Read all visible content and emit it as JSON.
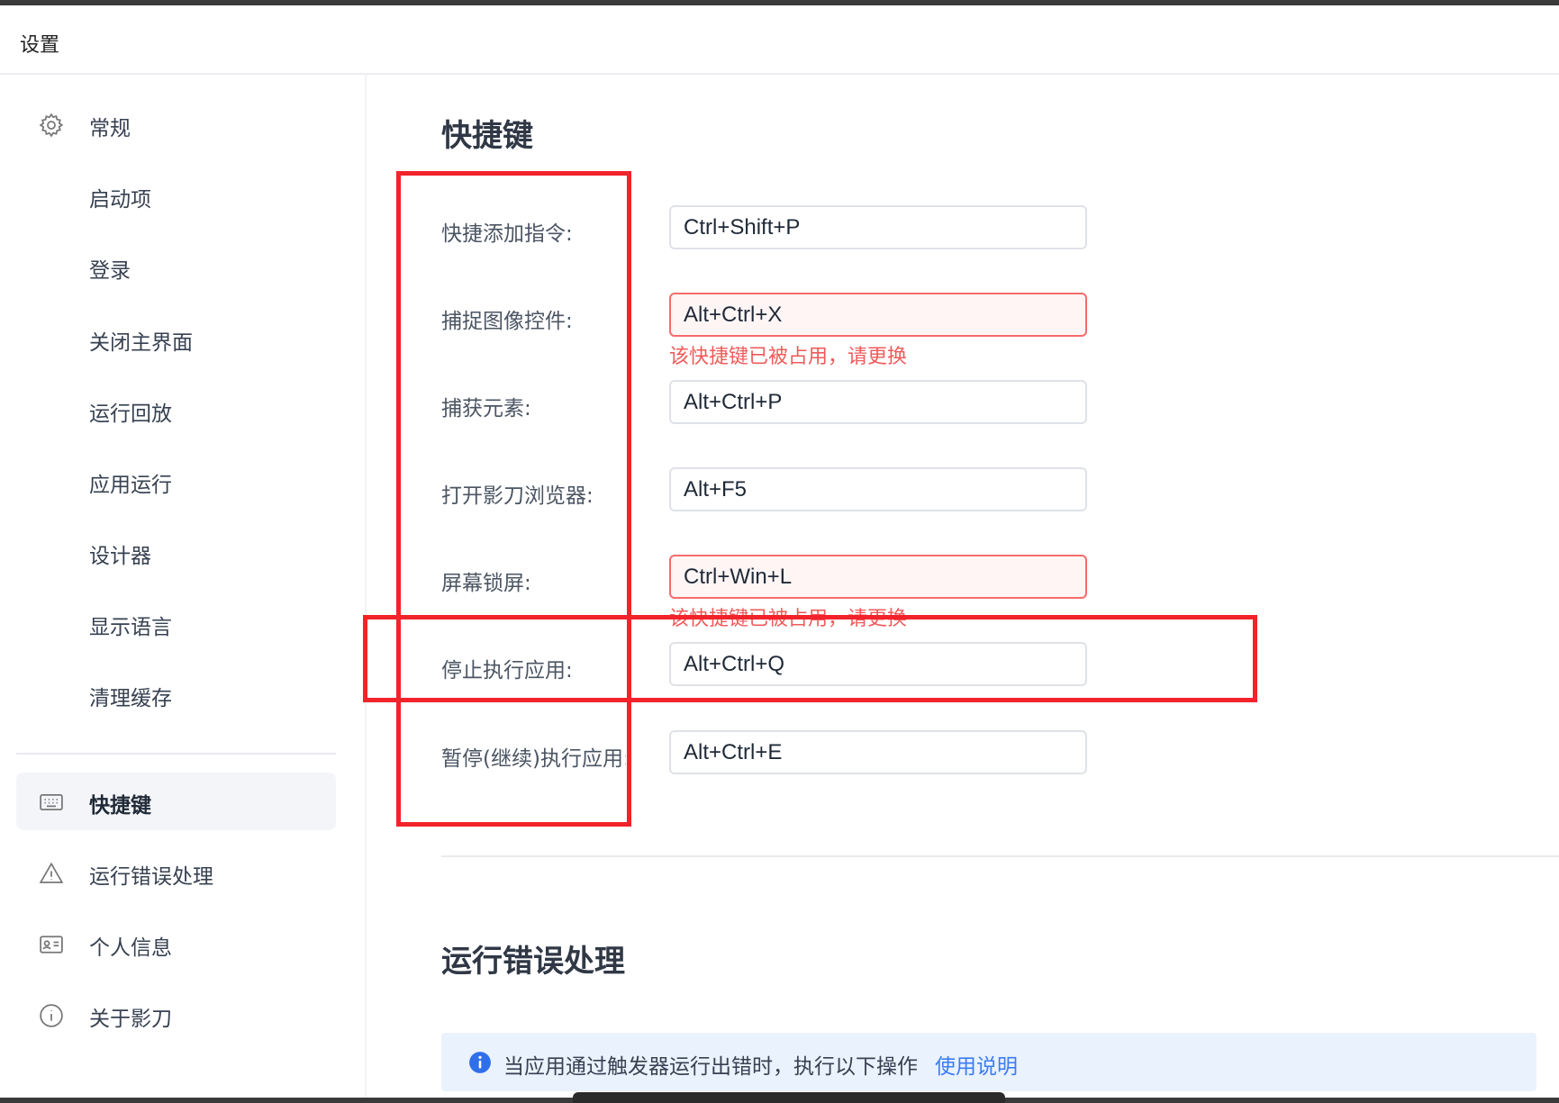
{
  "window": {
    "title": "设置"
  },
  "sidebar": {
    "items": [
      {
        "label": "常规",
        "icon": "gear-icon"
      },
      {
        "label": "启动项"
      },
      {
        "label": "登录"
      },
      {
        "label": "关闭主界面"
      },
      {
        "label": "运行回放"
      },
      {
        "label": "应用运行"
      },
      {
        "label": "设计器"
      },
      {
        "label": "显示语言"
      },
      {
        "label": "清理缓存"
      },
      {
        "label": "快捷键",
        "icon": "keyboard-icon",
        "active": true
      },
      {
        "label": "运行错误处理",
        "icon": "warning-icon"
      },
      {
        "label": "个人信息",
        "icon": "id-card-icon"
      },
      {
        "label": "关于影刀",
        "icon": "info-icon"
      }
    ]
  },
  "shortcuts": {
    "title": "快捷键",
    "fields": [
      {
        "label": "快捷添加指令:",
        "value": "Ctrl+Shift+P"
      },
      {
        "label": "捕捉图像控件:",
        "value": "Alt+Ctrl+X",
        "error": "该快捷键已被占用，请更换"
      },
      {
        "label": "捕获元素:",
        "value": "Alt+Ctrl+P"
      },
      {
        "label": "打开影刀浏览器:",
        "value": "Alt+F5"
      },
      {
        "label": "屏幕锁屏:",
        "value": "Ctrl+Win+L",
        "error": "该快捷键已被占用，请更换"
      },
      {
        "label": "停止执行应用:",
        "value": "Alt+Ctrl+Q"
      },
      {
        "label": "暂停(继续)执行应用:",
        "value": "Alt+Ctrl+E"
      }
    ]
  },
  "error_handling": {
    "title": "运行错误处理",
    "info_text": "当应用通过触发器运行出错时，执行以下操作",
    "info_link": "使用说明"
  },
  "colors": {
    "annotation_red": "#f2232b",
    "error_red": "#f05a5a",
    "link_blue": "#3b7cf4",
    "info_bg": "#eaf2fe",
    "active_nav_bg": "#f4f5f8"
  }
}
